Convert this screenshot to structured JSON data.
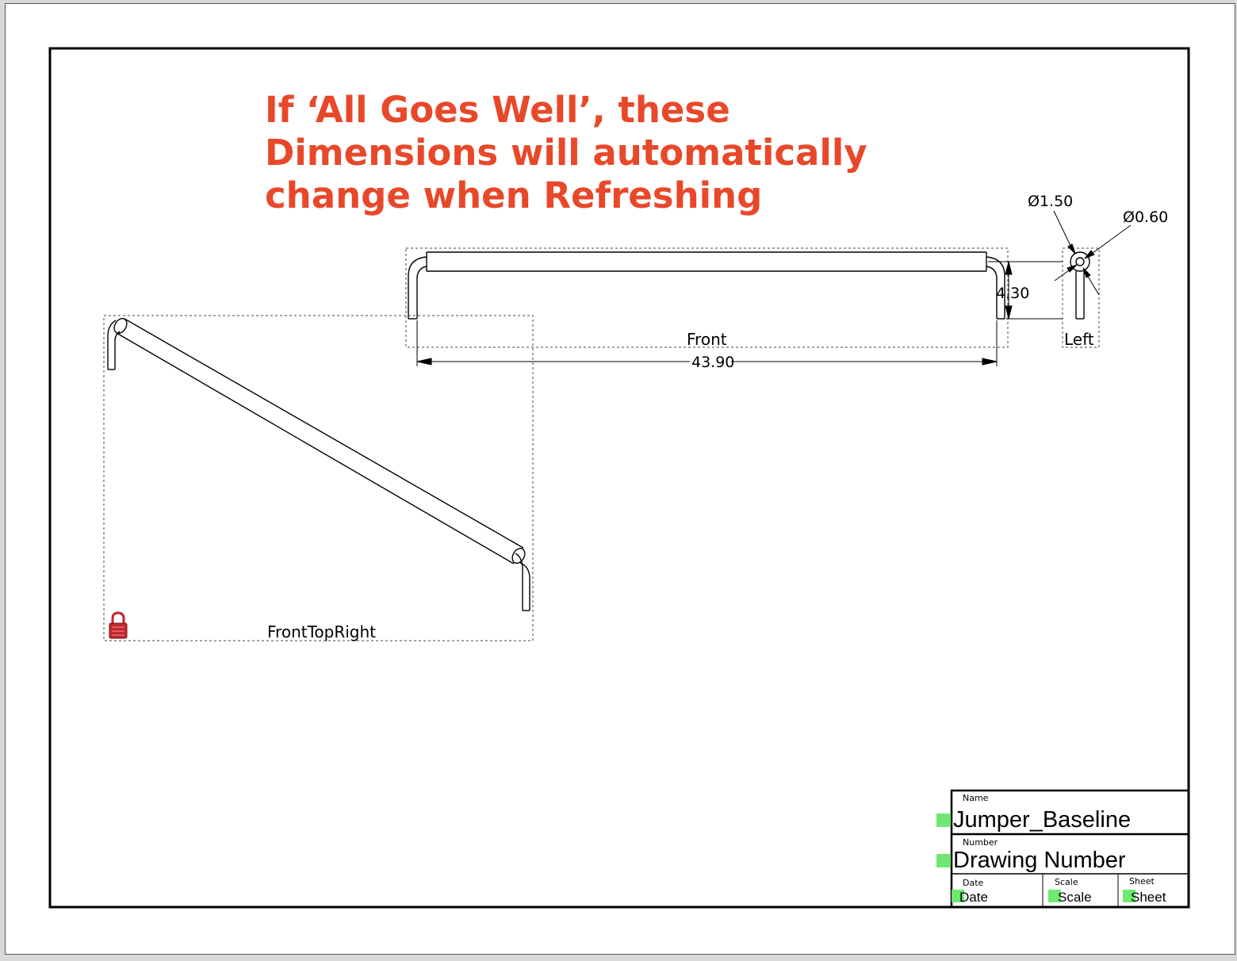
{
  "annotation": {
    "lines": [
      "If ‘All Goes Well’, these",
      "Dimensions will automatically",
      "change when Refreshing"
    ],
    "color": "#e8482a"
  },
  "views": {
    "front": {
      "label": "Front"
    },
    "left": {
      "label": "Left"
    },
    "iso": {
      "label": "FrontTopRight",
      "locked": true
    }
  },
  "dimensions": {
    "length": "43.90",
    "height": "4.30",
    "outer_diameter": "Ø1.50",
    "inner_diameter": "Ø0.60"
  },
  "title_block": {
    "name_caption": "Name",
    "name_value": "Jumper_Baseline",
    "number_caption": "Number",
    "number_value": "Drawing Number",
    "date_caption": "Date",
    "date_value": "Date",
    "scale_caption": "Scale",
    "scale_value": "Scale",
    "sheet_caption": "Sheet",
    "sheet_value": "Sheet",
    "editable_marker_color": "#6ee86e"
  },
  "icons": {
    "lock": "lock-icon"
  }
}
